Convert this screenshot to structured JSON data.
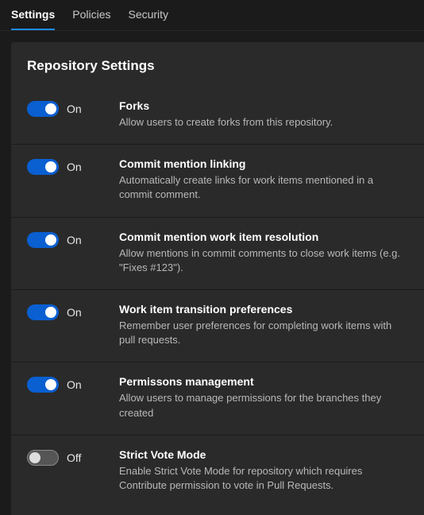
{
  "tabs": {
    "settings": "Settings",
    "policies": "Policies",
    "security": "Security"
  },
  "panel_title": "Repository Settings",
  "state_on": "On",
  "state_off": "Off",
  "settings": [
    {
      "id": "forks",
      "on": true,
      "title": "Forks",
      "desc": "Allow users to create forks from this repository."
    },
    {
      "id": "commit-mention-linking",
      "on": true,
      "title": "Commit mention linking",
      "desc": "Automatically create links for work items mentioned in a commit comment."
    },
    {
      "id": "commit-mention-resolution",
      "on": true,
      "title": "Commit mention work item resolution",
      "desc": "Allow mentions in commit comments to close work items (e.g. \"Fixes #123\")."
    },
    {
      "id": "work-item-transition",
      "on": true,
      "title": "Work item transition preferences",
      "desc": "Remember user preferences for completing work items with pull requests."
    },
    {
      "id": "permissions-management",
      "on": true,
      "title": "Permissons management",
      "desc": "Allow users to manage permissions for the branches they created"
    },
    {
      "id": "strict-vote-mode",
      "on": false,
      "title": "Strict Vote Mode",
      "desc": "Enable Strict Vote Mode for repository which requires Contribute permission to vote in Pull Requests."
    }
  ]
}
